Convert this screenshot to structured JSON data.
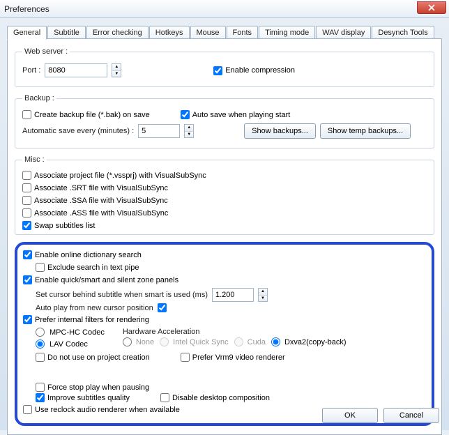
{
  "window": {
    "title": "Preferences"
  },
  "tabs": {
    "general": "General",
    "subtitle": "Subtitle",
    "error": "Error checking",
    "hotkeys": "Hotkeys",
    "mouse": "Mouse",
    "fonts": "Fonts",
    "timing": "Timing mode",
    "wav": "WAV display",
    "desynch": "Desynch Tools"
  },
  "webserver": {
    "legend": "Web server :",
    "port_label": "Port :",
    "port_value": "8080",
    "enable_compression": "Enable compression"
  },
  "backup": {
    "legend": "Backup :",
    "create_bak": "Create backup file (*.bak) on save",
    "autosave": "Auto save when playing start",
    "auto_every_label": "Automatic save every (minutes) :",
    "auto_every_value": "5",
    "show_backups": "Show backups...",
    "show_temp": "Show temp backups..."
  },
  "misc": {
    "legend": "Misc :",
    "assoc_vssprj": "Associate project file (*.vssprj) with VisualSubSync",
    "assoc_srt": "Associate .SRT file with VisualSubSync",
    "assoc_ssa": "Associate .SSA file with VisualSubSync",
    "assoc_ass": "Associate .ASS file with VisualSubSync",
    "swap_subs": "Swap subtitles list",
    "enable_dict": "Enable online dictionary search",
    "exclude_pipe": "Exclude search in text pipe",
    "enable_panels": "Enable quick/smart and silent zone panels",
    "cursor_label": "Set cursor behind subtitle when smart is used (ms)",
    "cursor_value": "1.200",
    "autoplay": "Auto play from new cursor position",
    "prefer_internal": "Prefer internal filters for rendering",
    "codec_mpc": "MPC-HC Codec",
    "codec_lav": "LAV Codec",
    "hw_title": "Hardware Acceleration",
    "hw_none": "None",
    "hw_intel": "Intel Quick Sync",
    "hw_cuda": "Cuda",
    "hw_dxva": "Dxva2(copy-back)",
    "no_use_project": "Do not use on project creation",
    "prefer_vmr9": "Prefer Vrm9 video renderer",
    "force_stop": "Force stop play when pausing",
    "improve_quality": "Improve subtitles quality",
    "disable_desktop": "Disable desktop composition",
    "reclock": "Use reclock audio renderer when available"
  },
  "buttons": {
    "ok": "OK",
    "cancel": "Cancel"
  }
}
